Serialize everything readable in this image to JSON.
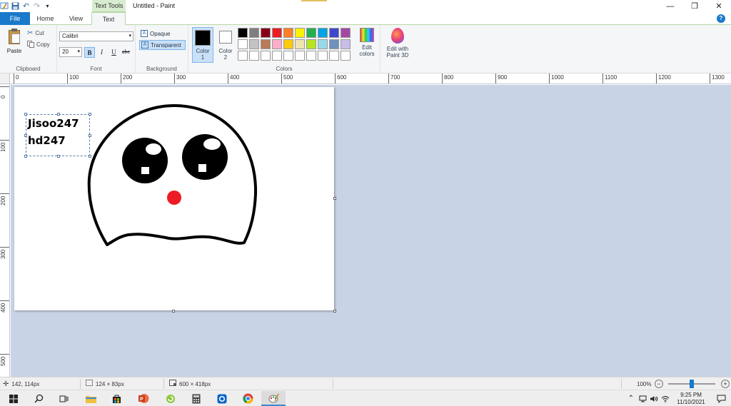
{
  "titlebar": {
    "context_tab": "Text Tools",
    "title": "Untitled - Paint",
    "controls": [
      "—",
      "❐",
      "✕"
    ]
  },
  "tabs": {
    "file": "File",
    "home": "Home",
    "view": "View",
    "text": "Text",
    "help": "?"
  },
  "ribbon": {
    "clipboard": {
      "label": "Clipboard",
      "paste": "Paste",
      "cut": "Cut",
      "copy": "Copy"
    },
    "font": {
      "label": "Font",
      "family": "Calibri",
      "size": "20",
      "bold": "B",
      "italic": "I",
      "underline": "U",
      "strikethrough": "abc"
    },
    "background": {
      "label": "Background",
      "opaque": "Opaque",
      "transparent": "Transparent",
      "selected": "transparent"
    },
    "colors": {
      "label": "Colors",
      "color1_label": "Color",
      "color1_num": "1",
      "color2_label": "Color",
      "color2_num": "2",
      "color1_value": "#000000",
      "color2_value": "#ffffff",
      "palette": [
        "#000000",
        "#7f7f7f",
        "#880015",
        "#ed1c24",
        "#ff7f27",
        "#fff200",
        "#22b14c",
        "#00a2e8",
        "#3f48cc",
        "#a349a4",
        "#ffffff",
        "#c3c3c3",
        "#b97a57",
        "#ffaec9",
        "#ffc90e",
        "#efe4b0",
        "#b5e61d",
        "#99d9ea",
        "#7092be",
        "#c8bfe7",
        "#ffffff",
        "#ffffff",
        "#ffffff",
        "#ffffff",
        "#ffffff",
        "#ffffff",
        "#ffffff",
        "#ffffff",
        "#ffffff",
        "#ffffff"
      ],
      "edit_colors": [
        "Edit",
        "colors"
      ]
    },
    "paint3d": {
      "label": [
        "Edit with",
        "Paint 3D"
      ]
    }
  },
  "rulers": {
    "horizontal": [
      "0",
      "100",
      "200",
      "300",
      "400",
      "500",
      "600",
      "700",
      "800",
      "900",
      "1000",
      "1100",
      "1200",
      "1300"
    ],
    "vertical": [
      "0",
      "100",
      "200",
      "300",
      "400",
      "500"
    ]
  },
  "canvas": {
    "text_lines": [
      "Jisoo247",
      "hd247"
    ],
    "text_color": "#000000",
    "nose_color": "#ed1c24"
  },
  "statusbar": {
    "cursor": "142, 114px",
    "selection": "124 × 83px",
    "canvas_size": "600 × 418px",
    "zoom": "100%",
    "zoom_percent": 100
  },
  "taskbar": {
    "apps": [
      "windows-start",
      "search",
      "task-view",
      "file-explorer",
      "store",
      "powerpoint",
      "greenshot",
      "calculator",
      "outlook",
      "chrome",
      "paint"
    ],
    "clock_time": "9:25 PM",
    "clock_date": "11/10/2021"
  },
  "colors": {
    "accent": "#1979ca",
    "workspace": "#c8d3e5",
    "ribbon": "#f5f6f7"
  }
}
